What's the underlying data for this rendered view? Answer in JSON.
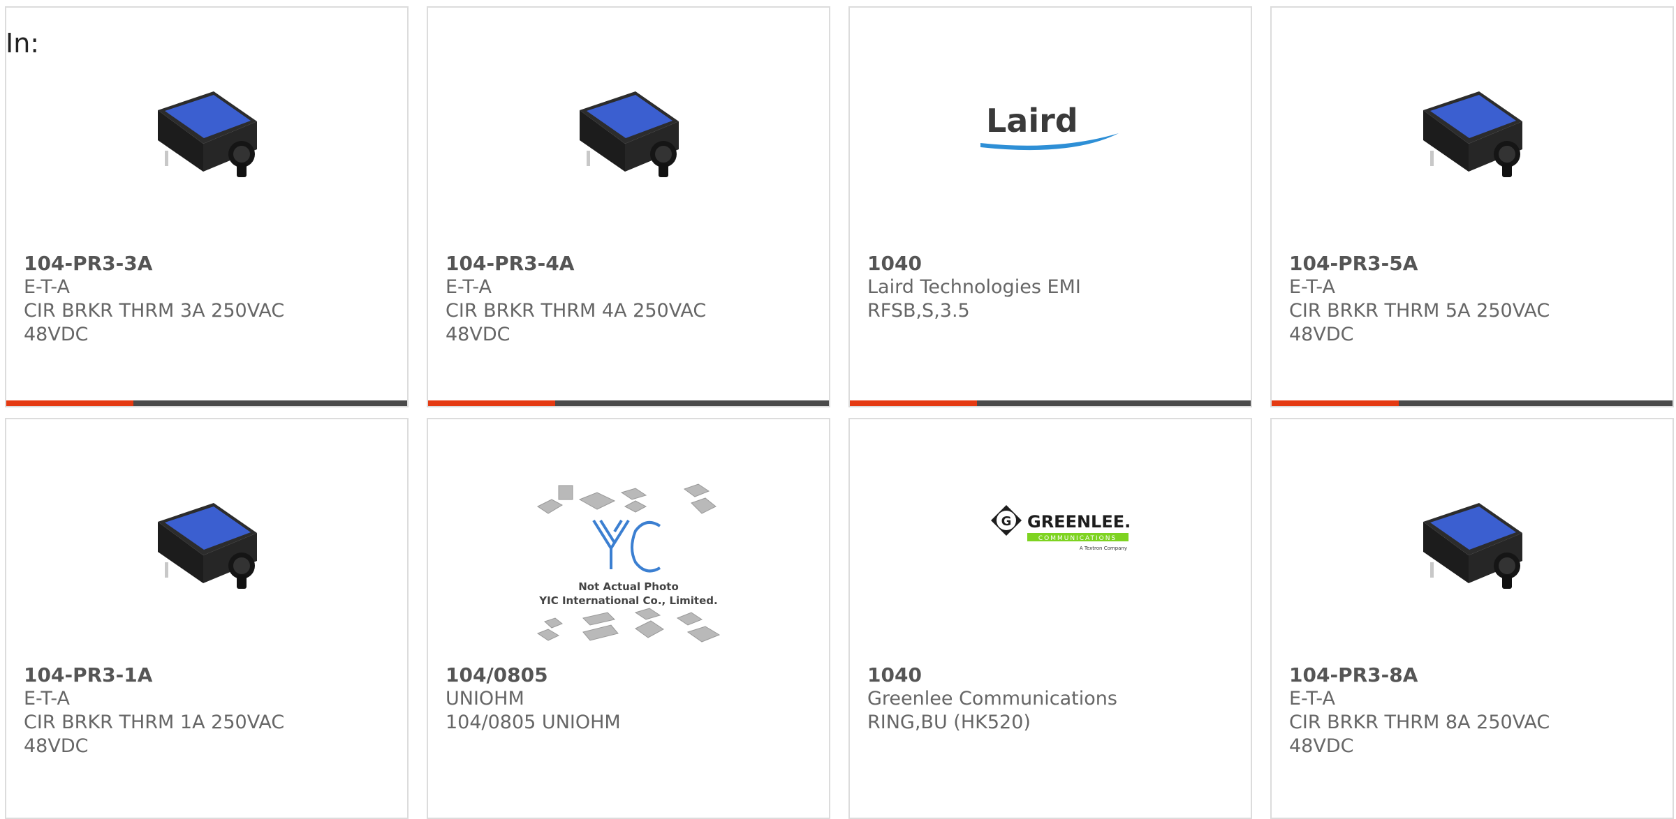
{
  "page": {
    "label": "In:"
  },
  "colors": {
    "accent": "#e43a12",
    "bar": "#4a4a4a",
    "border": "#dcdcdc",
    "text": "#666666"
  },
  "cards": [
    {
      "part_number": "104-PR3-3A",
      "manufacturer": "E-T-A",
      "description": "CIR BRKR THRM 3A 250VAC\n48VDC",
      "image": "circuit-breaker-image"
    },
    {
      "part_number": "104-PR3-4A",
      "manufacturer": "E-T-A",
      "description": "CIR BRKR THRM 4A 250VAC\n48VDC",
      "image": "circuit-breaker-image"
    },
    {
      "part_number": "1040",
      "manufacturer": "Laird Technologies EMI",
      "description": "RFSB,S,3.5",
      "image": "laird-logo",
      "logo_text": "Laird"
    },
    {
      "part_number": "104-PR3-5A",
      "manufacturer": "E-T-A",
      "description": "CIR BRKR THRM 5A 250VAC\n48VDC",
      "image": "circuit-breaker-image"
    },
    {
      "part_number": "104-PR3-1A",
      "manufacturer": "E-T-A",
      "description": "CIR BRKR THRM 1A 250VAC\n48VDC",
      "image": "circuit-breaker-image"
    },
    {
      "part_number": "104/0805",
      "manufacturer": "UNIOHM",
      "description": "104/0805 UNIOHM",
      "image": "yic-placeholder-image",
      "photo_note_1": "Not Actual Photo",
      "photo_note_2": "YIC International Co., Limited."
    },
    {
      "part_number": "1040",
      "manufacturer": "Greenlee Communications",
      "description": "RING,BU (HK520)",
      "image": "greenlee-logo",
      "logo_text": "GREENLEE.",
      "logo_sub": "COMMUNICATIONS",
      "logo_tag": "A Textron Company"
    },
    {
      "part_number": "104-PR3-8A",
      "manufacturer": "E-T-A",
      "description": "CIR BRKR THRM 8A 250VAC\n48VDC",
      "image": "circuit-breaker-image"
    }
  ]
}
